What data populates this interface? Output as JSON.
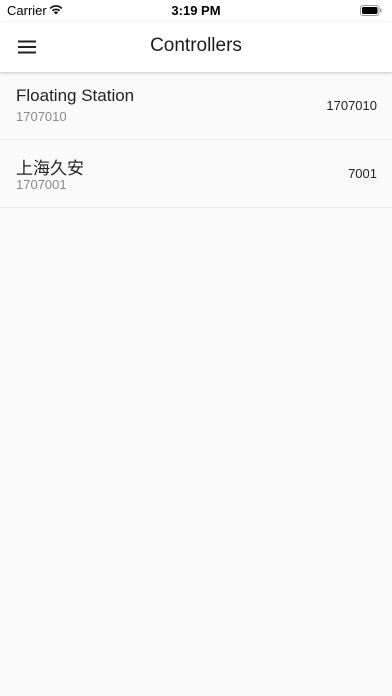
{
  "status_bar": {
    "carrier": "Carrier",
    "time": "3:19 PM"
  },
  "app_bar": {
    "title": "Controllers",
    "menu_icon": "hamburger-menu-icon"
  },
  "controllers": [
    {
      "name": "Floating Station",
      "id": "1707010",
      "value": "1707010"
    },
    {
      "name": "上海久安",
      "id": "1707001",
      "value": "7001"
    }
  ],
  "colors": {
    "background": "#fafafa",
    "app_bar": "#ffffff",
    "secondary_text": "#8a8a8a"
  }
}
